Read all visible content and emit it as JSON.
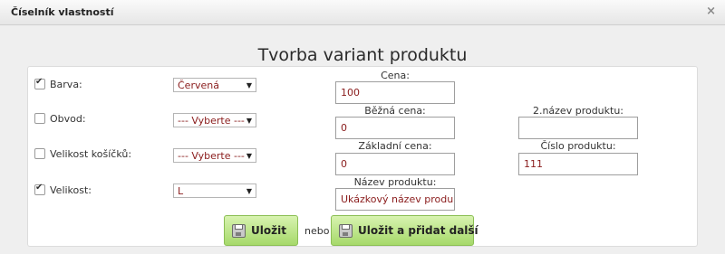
{
  "dialog": {
    "title": "Číselník vlastností",
    "close_symbol": "×"
  },
  "heading": "Tvorba variant produktu",
  "options": [
    {
      "label": "Barva:",
      "checked": true,
      "select_value": "Červená"
    },
    {
      "label": "Obvod:",
      "checked": false,
      "select_value": "--- Vyberte ---"
    },
    {
      "label": "Velikost košíčků:",
      "checked": false,
      "select_value": "--- Vyberte ---"
    },
    {
      "label": "Velikost:",
      "checked": true,
      "select_value": "L"
    }
  ],
  "fields": {
    "cena": {
      "label": "Cena:",
      "value": "100"
    },
    "bezna_cena": {
      "label": "Běžná cena:",
      "value": "0"
    },
    "zakladni_cena": {
      "label": "Základní cena:",
      "value": "0"
    },
    "nazev_produktu": {
      "label": "Název produktu:",
      "value": "Ukázkový název produk"
    },
    "nazev_produktu_2": {
      "label": "2.název produktu:",
      "value": ""
    },
    "cislo_produktu": {
      "label": "Číslo produktu:",
      "value": "111"
    }
  },
  "buttons": {
    "save": "Uložit",
    "separator": "nebo",
    "save_add": "Uložit a přidat další"
  },
  "select_arrow": "▼",
  "colors": {
    "accent_green": "#a6d96a",
    "value_text": "#8a1c1c"
  }
}
